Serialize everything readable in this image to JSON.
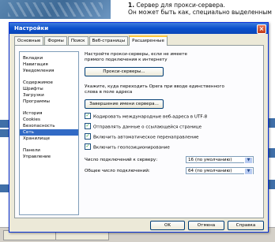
{
  "background": {
    "text_lines": [
      "Сервер для прокси-сервера.",
      "Он может быть как, специально выделенным",
      "",
      ""
    ],
    "step_number": "1."
  },
  "dialog": {
    "title": "Настройки",
    "close_label": "×",
    "tabs": [
      "Основные",
      "Формы",
      "Поиск",
      "Веб-страницы",
      "Расширенные"
    ],
    "sidebar": [
      "Вкладки",
      "Навигация",
      "Уведомления",
      "",
      "Содержимое",
      "Шрифты",
      "Загрузки",
      "Программы",
      "",
      "История",
      "Cookies",
      "Безопасность",
      "Сеть",
      "Хранилище",
      "",
      "Панели",
      "Управление"
    ],
    "content": {
      "intro": "Настройте прокси-серверы, если не имеете прямого подключения к интернету",
      "proxy_button": "Прокси-серверы...",
      "hint": "Укажите, куда переходить Opera при вводе единственного слова в поле адреса",
      "completion_button": "Завершение имени сервера...",
      "checkboxes": [
        {
          "label": "Кодировать международные веб-адреса в UTF-8",
          "checked": true
        },
        {
          "label": "Отправлять данные о ссылающейся странице",
          "checked": true
        },
        {
          "label": "Включить автоматическое перенаправление",
          "checked": true
        },
        {
          "label": "Включить геопозиционирование",
          "checked": true
        }
      ],
      "max_per_server_label": "Число подключений к серверу:",
      "max_per_server_value": "16 (по умолчанию)",
      "max_total_label": "Общее число подключений:",
      "max_total_value": "64 (по умолчанию)"
    },
    "footer": {
      "ok": "OK",
      "cancel": "Отмена",
      "help": "Справка"
    }
  }
}
